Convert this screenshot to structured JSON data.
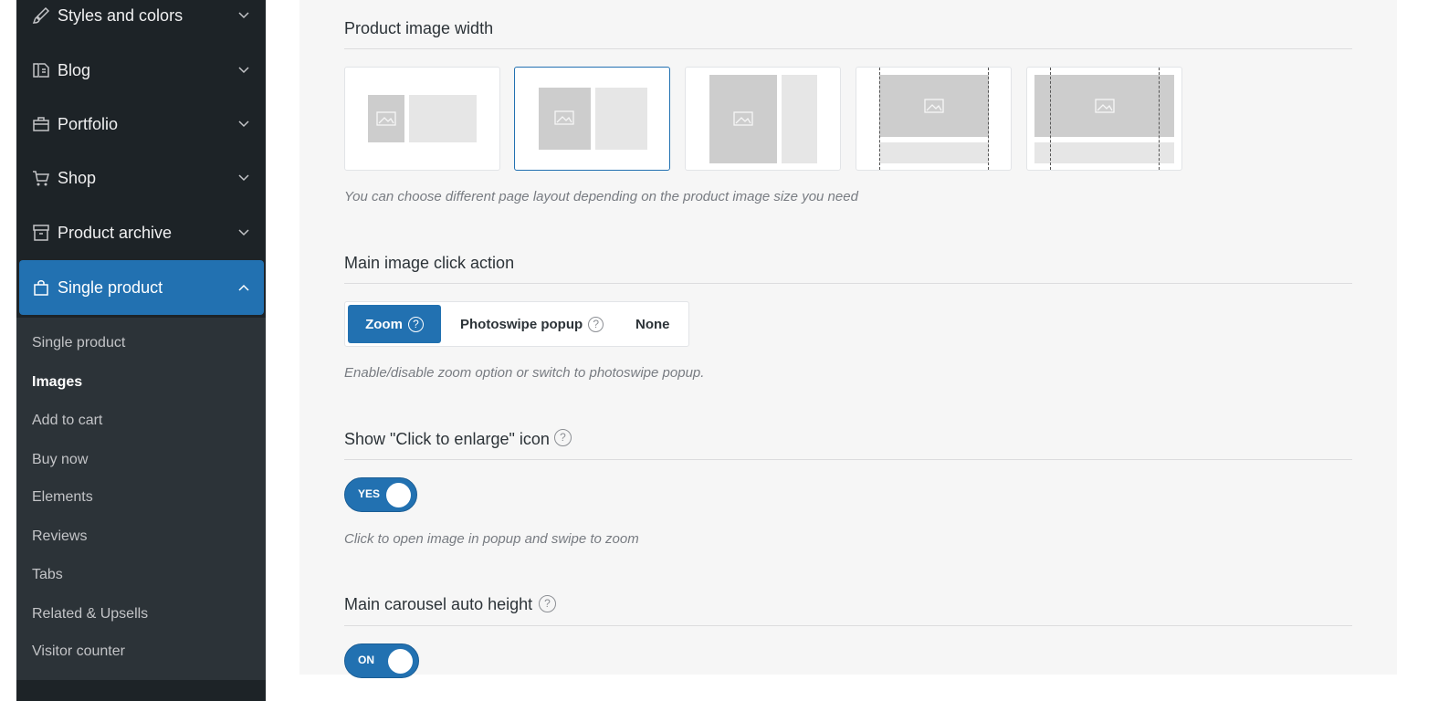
{
  "sidebar": {
    "items": [
      {
        "label": "Styles and colors",
        "icon": "brush-icon"
      },
      {
        "label": "Blog",
        "icon": "blog-icon"
      },
      {
        "label": "Portfolio",
        "icon": "briefcase-icon"
      },
      {
        "label": "Shop",
        "icon": "cart-icon"
      },
      {
        "label": "Product archive",
        "icon": "archive-icon"
      },
      {
        "label": "Single product",
        "icon": "bag-icon",
        "active": true
      }
    ],
    "submenu": [
      {
        "label": "Single product"
      },
      {
        "label": "Images",
        "current": true
      },
      {
        "label": "Add to cart"
      },
      {
        "label": "Buy now"
      },
      {
        "label": "Elements"
      },
      {
        "label": "Reviews"
      },
      {
        "label": "Tabs"
      },
      {
        "label": "Related & Upsells"
      },
      {
        "label": "Visitor counter"
      }
    ]
  },
  "main": {
    "image_width": {
      "title": "Product image width",
      "description": "You can choose different page layout depending on the product image size you need",
      "selected_option": 2
    },
    "click_action": {
      "title": "Main image click action",
      "options": [
        "Zoom",
        "Photoswipe popup",
        "None"
      ],
      "selected": "Zoom",
      "help_glyph": "?",
      "description": "Enable/disable zoom option or switch to photoswipe popup."
    },
    "enlarge_icon": {
      "title": "Show \"Click to enlarge\" icon",
      "help_glyph": "?",
      "toggle_label": "YES",
      "description": "Click to open image in popup and swipe to zoom"
    },
    "auto_height": {
      "title": "Main carousel auto height",
      "help_glyph": "?",
      "toggle_label": "ON"
    }
  },
  "colors": {
    "accent": "#2271b1",
    "sidebar_bg": "#1d2327",
    "submenu_bg": "#2c3338",
    "panel_bg": "#f6f6f6"
  }
}
